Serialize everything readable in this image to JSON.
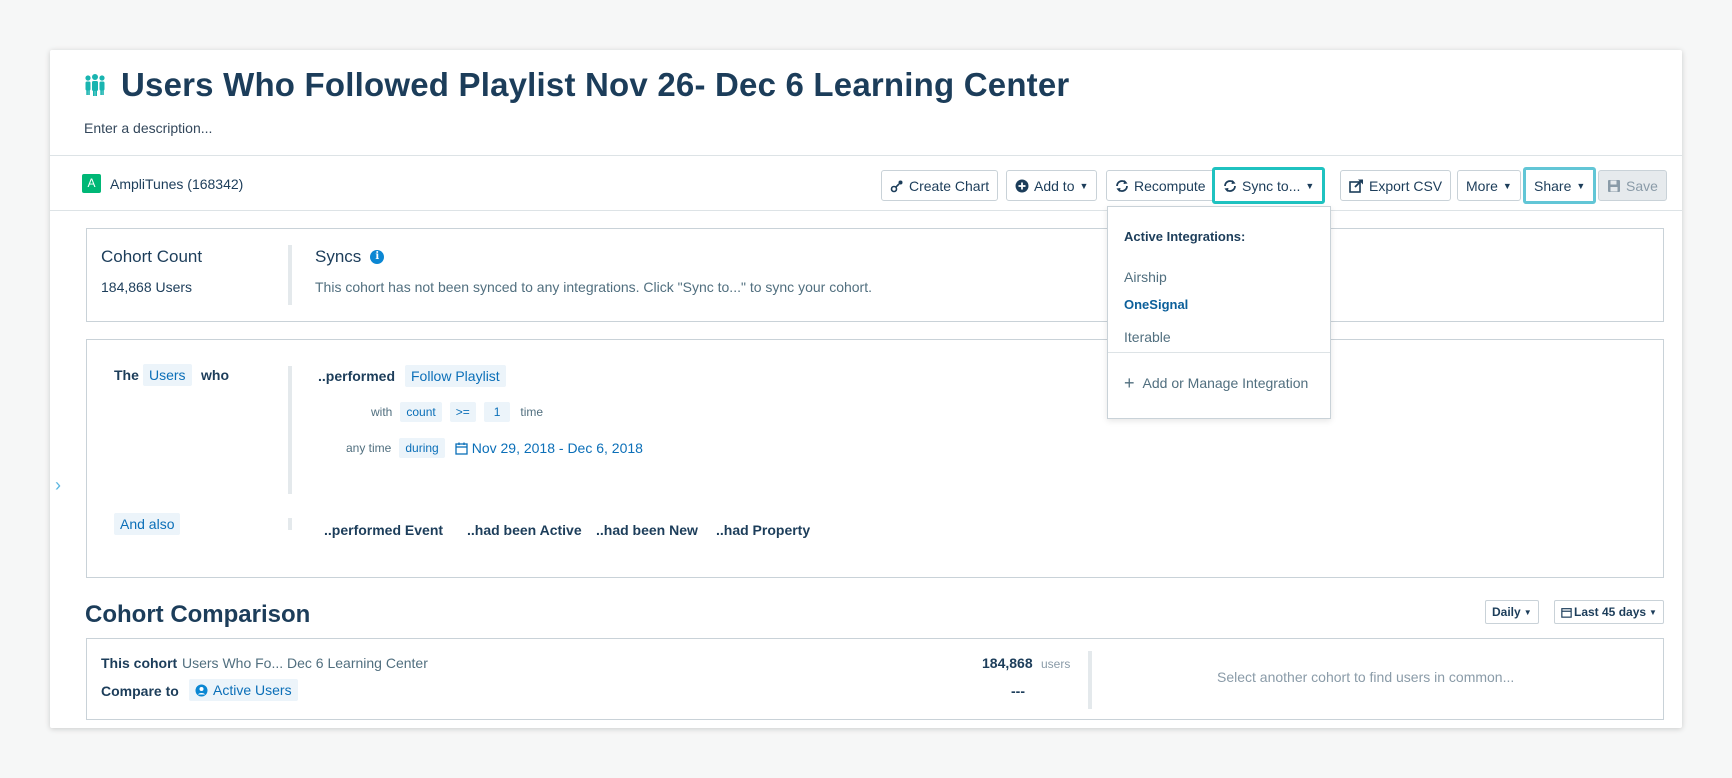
{
  "header": {
    "title": "Users Who Followed Playlist Nov 26- Dec 6 Learning Center",
    "description_placeholder": "Enter a description..."
  },
  "toolbar": {
    "project_badge": "A",
    "project_label": "AmpliTunes (168342)",
    "create_chart": "Create Chart",
    "add_to": "Add to",
    "recompute": "Recompute",
    "sync_to": "Sync to...",
    "export_csv": "Export CSV",
    "more": "More",
    "share": "Share",
    "save": "Save"
  },
  "summary": {
    "cohort_count_label": "Cohort Count",
    "cohort_count_value": "184,868 Users",
    "syncs_label": "Syncs",
    "syncs_message": "This cohort has not been synced to any integrations. Click \"Sync to...\" to sync your cohort."
  },
  "sync_dropdown": {
    "heading": "Active Integrations:",
    "items": [
      "Airship",
      "OneSignal",
      "Iterable"
    ],
    "add_label": "Add or Manage Integration"
  },
  "definition": {
    "the": "The",
    "users": "Users",
    "who": "who",
    "performed": "..performed",
    "event": "Follow Playlist",
    "with": "with",
    "count": "count",
    "operator": ">=",
    "count_value": "1",
    "time": "time",
    "any_time": "any time",
    "during": "during",
    "date_range": "Nov 29, 2018 - Dec 6, 2018",
    "and_also": "And also",
    "also_options": [
      "..performed Event",
      "..had been Active",
      "..had been New",
      "..had Property"
    ]
  },
  "comparison": {
    "title": "Cohort Comparison",
    "interval": "Daily",
    "range": "Last 45 days",
    "this_cohort_label": "This cohort",
    "this_cohort_name": "Users Who Fo... Dec 6 Learning Center",
    "this_cohort_count": "184,868",
    "users_unit": "users",
    "compare_to_label": "Compare to",
    "compare_to_value": "Active Users",
    "compare_count": "---",
    "empty_hint": "Select another cohort to find users in common..."
  },
  "colors": {
    "accent_teal": "#1fc2c0",
    "link_blue": "#0b6fb8",
    "project_green": "#00b776"
  }
}
